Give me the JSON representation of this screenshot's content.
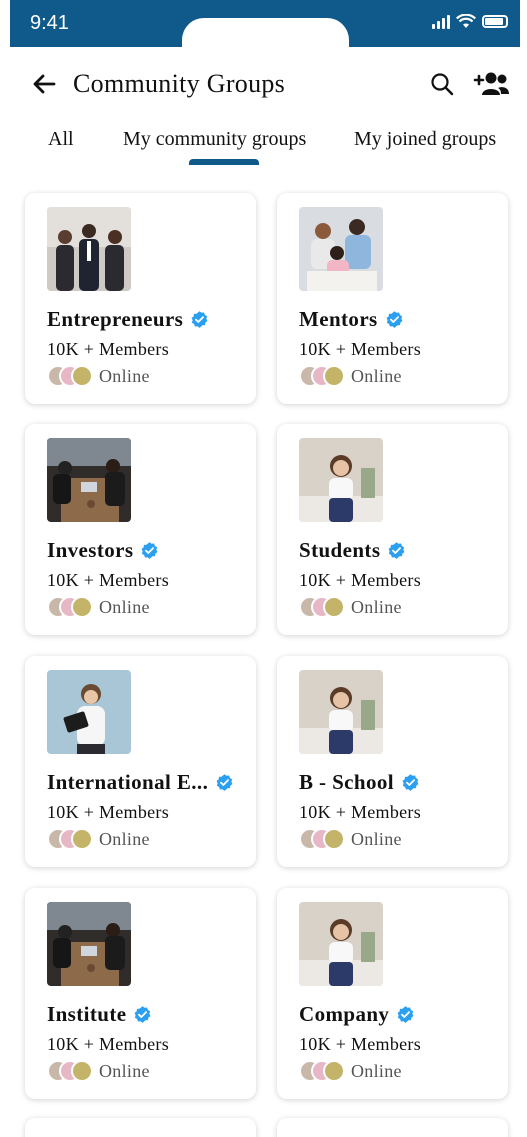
{
  "status_bar": {
    "time": "9:41"
  },
  "header": {
    "title": "Community Groups"
  },
  "tabs": [
    {
      "label": "All"
    },
    {
      "label": "My community groups"
    },
    {
      "label": "My joined groups"
    }
  ],
  "active_tab": "My community groups",
  "colors": {
    "brand": "#0f5a8a",
    "verified": "#2b9ff0"
  },
  "groups": [
    {
      "name": "Entrepreneurs",
      "members": "10K + Members",
      "status": "Online"
    },
    {
      "name": "Mentors",
      "members": "10K + Members",
      "status": "Online"
    },
    {
      "name": "Investors",
      "members": "10K + Members",
      "status": "Online"
    },
    {
      "name": "Students",
      "members": "10K + Members",
      "status": "Online"
    },
    {
      "name": "International E...",
      "members": "10K + Members",
      "status": "Online"
    },
    {
      "name": "B - School",
      "members": "10K + Members",
      "status": "Online"
    },
    {
      "name": "Institute",
      "members": "10K + Members",
      "status": "Online"
    },
    {
      "name": "Company",
      "members": "10K + Members",
      "status": "Online"
    }
  ]
}
